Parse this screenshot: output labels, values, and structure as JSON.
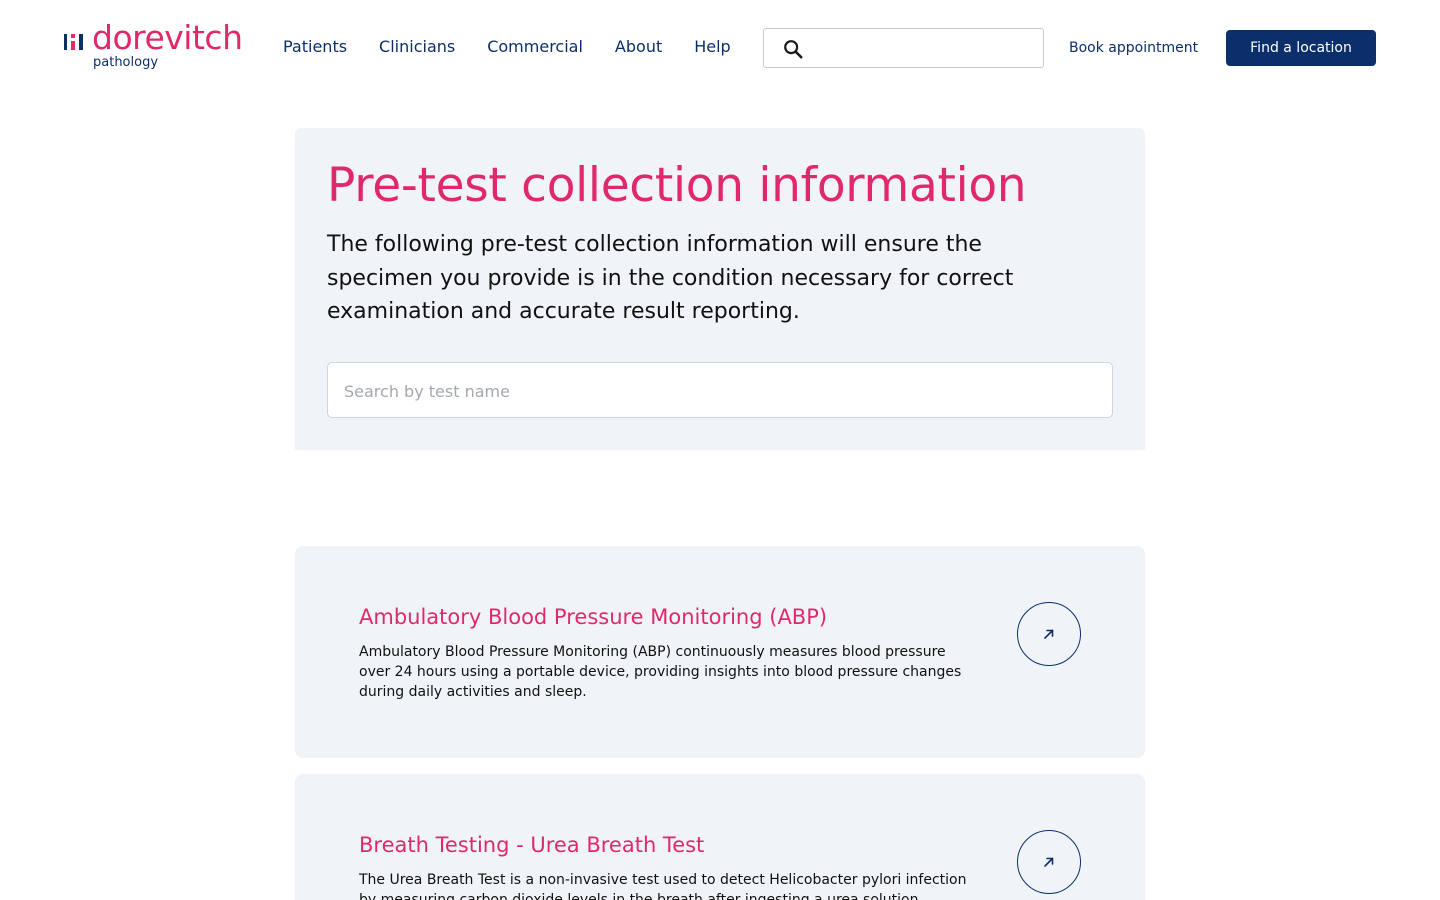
{
  "brand": {
    "name": "dorevitch",
    "sub": "pathology",
    "pink": "#e0296b",
    "navy": "#0b2f6b"
  },
  "nav": {
    "items": [
      {
        "label": "Patients"
      },
      {
        "label": "Clinicians"
      },
      {
        "label": "Commercial"
      },
      {
        "label": "About"
      },
      {
        "label": "Help"
      }
    ]
  },
  "header_search": {
    "icon": "search-icon",
    "value": "",
    "placeholder": ""
  },
  "header_actions": {
    "book_label": "Book appointment",
    "find_label": "Find a location"
  },
  "hero": {
    "title": "Pre-test collection information",
    "description": "The following pre-test collection information will ensure the specimen you provide is in the condition necessary for correct examination and accurate result reporting.",
    "search_placeholder": "Search by test name",
    "search_value": ""
  },
  "tests": [
    {
      "title": "Ambulatory Blood Pressure Monitoring (ABP)",
      "description": "Ambulatory Blood Pressure Monitoring (ABP) continuously measures blood pressure over 24 hours using a portable device, providing insights into blood pressure changes during daily activities and sleep.",
      "icon": "arrow-up-right-icon"
    },
    {
      "title": "Breath Testing - Urea Breath Test",
      "description": "The Urea Breath Test is a non-invasive test used to detect Helicobacter pylori infection by measuring carbon dioxide levels in the breath after ingesting a urea solution.",
      "icon": "arrow-up-right-icon"
    }
  ]
}
